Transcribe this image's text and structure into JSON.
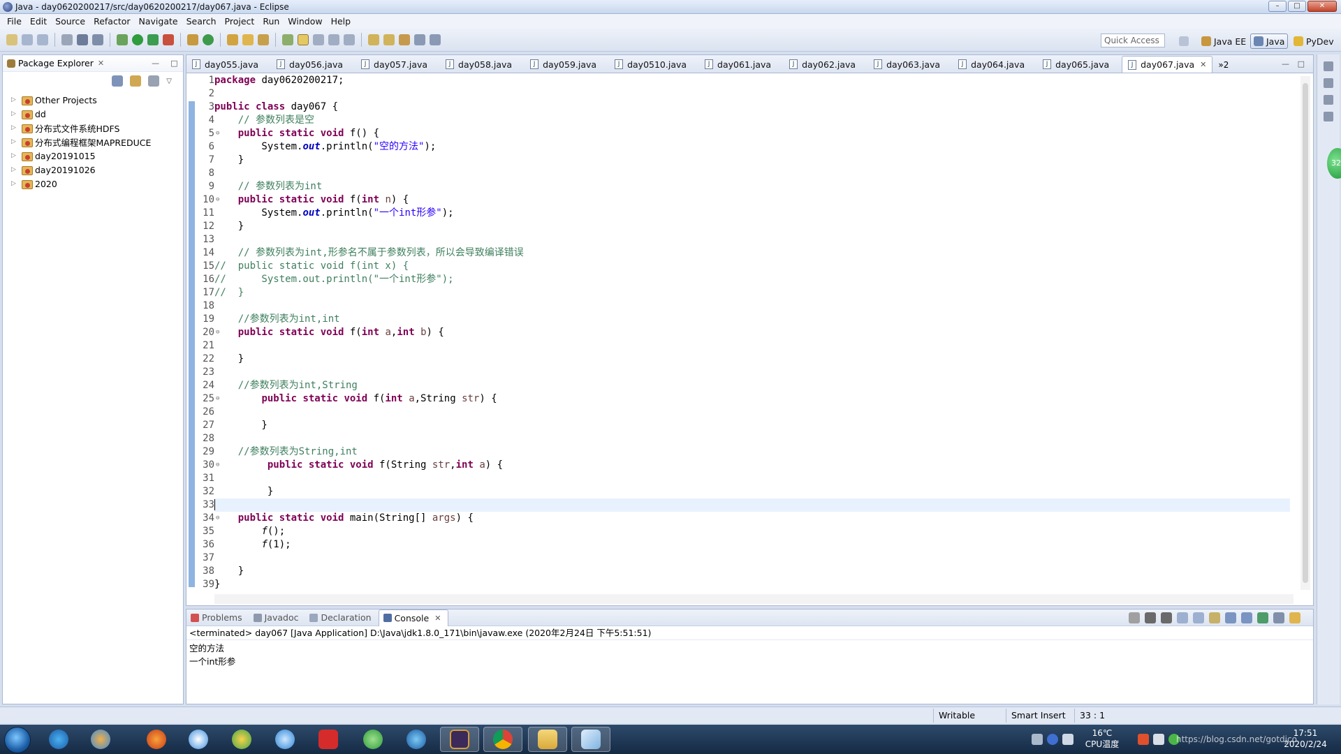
{
  "window": {
    "title": "Java - day0620200217/src/day0620200217/day067.java - Eclipse"
  },
  "menu": [
    "File",
    "Edit",
    "Source",
    "Refactor",
    "Navigate",
    "Search",
    "Project",
    "Run",
    "Window",
    "Help"
  ],
  "toolbar": {
    "quick_access_placeholder": "Quick Access"
  },
  "perspectives": [
    {
      "label": "Java EE",
      "active": false
    },
    {
      "label": "Java",
      "active": true
    },
    {
      "label": "PyDev",
      "active": false
    }
  ],
  "package_explorer": {
    "title": "Package Explorer",
    "items": [
      "Other Projects",
      "dd",
      "分布式文件系统HDFS",
      "分布式编程框架MAPREDUCE",
      "day20191015",
      "day20191026",
      "2020"
    ]
  },
  "editor": {
    "tabs": [
      "day055.java",
      "day056.java",
      "day057.java",
      "day058.java",
      "day059.java",
      "day0510.java",
      "day061.java",
      "day062.java",
      "day063.java",
      "day064.java",
      "day065.java",
      "day067.java"
    ],
    "active_tab": "day067.java",
    "overflow": "»2",
    "current_line": 33,
    "lines": [
      [
        [
          "kw",
          "package"
        ],
        [
          "p",
          " day0620200217;"
        ]
      ],
      [],
      [
        [
          "kw",
          "public class"
        ],
        [
          "p",
          " day067 {"
        ]
      ],
      [
        [
          "p",
          "    "
        ],
        [
          "cm",
          "// 参数列表是空"
        ]
      ],
      [
        [
          "p",
          "    "
        ],
        [
          "kw",
          "public static void"
        ],
        [
          "p",
          " f() {"
        ]
      ],
      [
        [
          "p",
          "        System."
        ],
        [
          "fld",
          "out"
        ],
        [
          "p",
          ".println("
        ],
        [
          "str",
          "\"空的方法\""
        ],
        [
          "p",
          ");"
        ]
      ],
      [
        [
          "p",
          "    }"
        ]
      ],
      [],
      [
        [
          "p",
          "    "
        ],
        [
          "cm",
          "// 参数列表为int"
        ]
      ],
      [
        [
          "p",
          "    "
        ],
        [
          "kw",
          "public static void"
        ],
        [
          "p",
          " f("
        ],
        [
          "kw",
          "int"
        ],
        [
          "p",
          " "
        ],
        [
          "var",
          "n"
        ],
        [
          "p",
          ") {"
        ]
      ],
      [
        [
          "p",
          "        System."
        ],
        [
          "fld",
          "out"
        ],
        [
          "p",
          ".println("
        ],
        [
          "str",
          "\"一个int形参\""
        ],
        [
          "p",
          ");"
        ]
      ],
      [
        [
          "p",
          "    }"
        ]
      ],
      [],
      [
        [
          "p",
          "    "
        ],
        [
          "cm",
          "// 参数列表为int,形参名不属于参数列表，所以会导致编译错误"
        ]
      ],
      [
        [
          "cm",
          "//  public static void f(int x) {"
        ]
      ],
      [
        [
          "cm",
          "//      System.out.println(\"一个int形参\");"
        ]
      ],
      [
        [
          "cm",
          "//  }"
        ]
      ],
      [],
      [
        [
          "p",
          "    "
        ],
        [
          "cm",
          "//参数列表为int,int"
        ]
      ],
      [
        [
          "p",
          "    "
        ],
        [
          "kw",
          "public static void"
        ],
        [
          "p",
          " f("
        ],
        [
          "kw",
          "int"
        ],
        [
          "p",
          " "
        ],
        [
          "var",
          "a"
        ],
        [
          "p",
          ","
        ],
        [
          "kw",
          "int"
        ],
        [
          "p",
          " "
        ],
        [
          "var",
          "b"
        ],
        [
          "p",
          ") {"
        ]
      ],
      [],
      [
        [
          "p",
          "    }"
        ]
      ],
      [],
      [
        [
          "p",
          "    "
        ],
        [
          "cm",
          "//参数列表为int,String"
        ]
      ],
      [
        [
          "p",
          "        "
        ],
        [
          "kw",
          "public static void"
        ],
        [
          "p",
          " f("
        ],
        [
          "kw",
          "int"
        ],
        [
          "p",
          " "
        ],
        [
          "var",
          "a"
        ],
        [
          "p",
          ",String "
        ],
        [
          "var",
          "str"
        ],
        [
          "p",
          ") {"
        ]
      ],
      [],
      [
        [
          "p",
          "        }"
        ]
      ],
      [],
      [
        [
          "p",
          "    "
        ],
        [
          "cm",
          "//参数列表为String,int"
        ]
      ],
      [
        [
          "p",
          "         "
        ],
        [
          "kw",
          "public static void"
        ],
        [
          "p",
          " f(String "
        ],
        [
          "var",
          "str"
        ],
        [
          "p",
          ","
        ],
        [
          "kw",
          "int"
        ],
        [
          "p",
          " "
        ],
        [
          "var",
          "a"
        ],
        [
          "p",
          ") {"
        ]
      ],
      [],
      [
        [
          "p",
          "         }"
        ]
      ],
      [],
      [
        [
          "p",
          "    "
        ],
        [
          "kw",
          "public static void"
        ],
        [
          "p",
          " main(String[] "
        ],
        [
          "var",
          "args"
        ],
        [
          "p",
          ") {"
        ]
      ],
      [
        [
          "p",
          "        "
        ],
        [
          "it",
          "f"
        ],
        [
          "p",
          "();"
        ]
      ],
      [
        [
          "p",
          "        "
        ],
        [
          "it",
          "f"
        ],
        [
          "p",
          "(1);"
        ]
      ],
      [],
      [
        [
          "p",
          "    }"
        ]
      ],
      [
        [
          "p",
          "}"
        ]
      ]
    ]
  },
  "console": {
    "tabs": [
      "Problems",
      "Javadoc",
      "Declaration",
      "Console"
    ],
    "active_tab": "Console",
    "terminated": "<terminated> day067 [Java Application] D:\\Java\\jdk1.8.0_171\\bin\\javaw.exe (2020年2月24日 下午5:51:51)",
    "output": [
      "空的方法",
      "一个int形参"
    ]
  },
  "status": {
    "writable": "Writable",
    "insert_mode": "Smart Insert",
    "position": "33 : 1"
  },
  "taskbar": {
    "temperature": "16℃",
    "cpu_label": "CPU温度",
    "time": "17:51",
    "date": "2020/2/24",
    "watermark": "https://blog.csdn.net/gotdjco"
  },
  "side_badge": "32",
  "colors": {
    "keyword": "#7f0055",
    "comment": "#3f7f5f",
    "string": "#2a00ff",
    "field": "#0000c0",
    "ruler": "#8fb4e2"
  }
}
